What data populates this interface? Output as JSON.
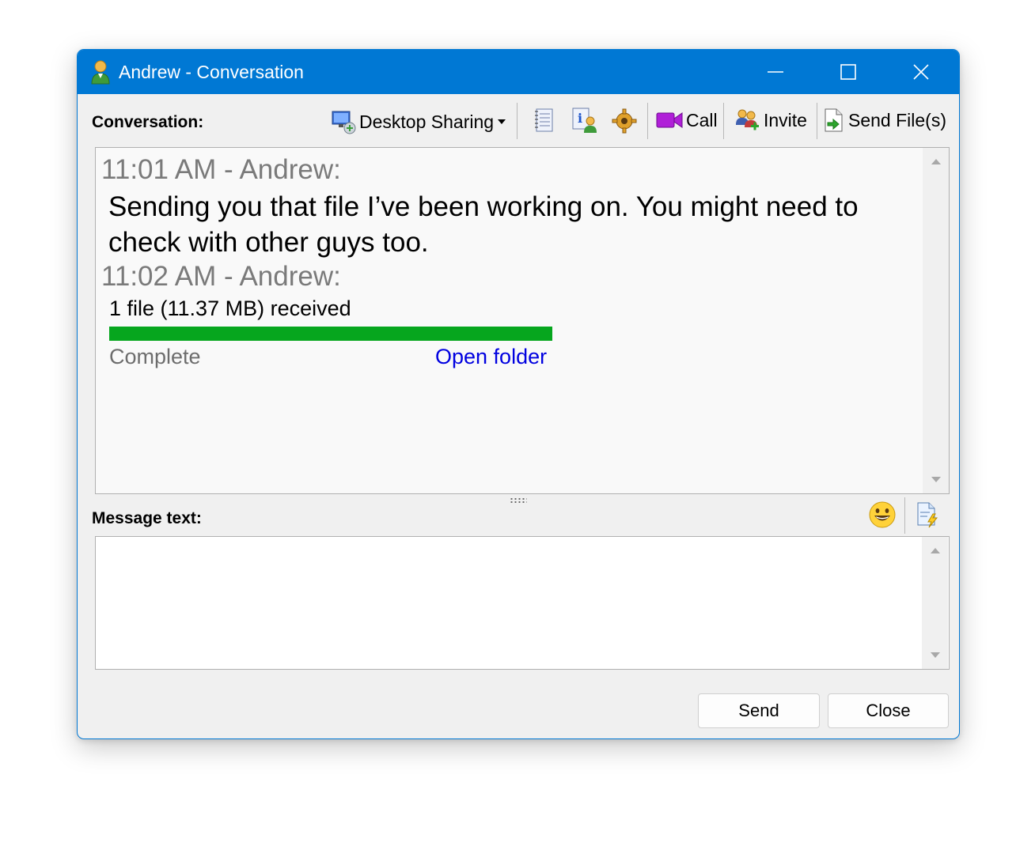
{
  "window": {
    "title": "Andrew - Conversation",
    "accent_color": "#0078d4"
  },
  "toolbar": {
    "conversation_label": "Conversation:",
    "desktop_sharing_label": "Desktop Sharing",
    "call_label": "Call",
    "invite_label": "Invite",
    "send_files_label": "Send File(s)",
    "icons": [
      "desktop-sharing-icon",
      "dropdown-arrow-icon",
      "notebook-icon",
      "user-info-icon",
      "settings-gear-icon",
      "video-camera-icon",
      "invite-users-icon",
      "send-file-icon"
    ]
  },
  "conversation": {
    "messages": [
      {
        "header": "11:01 AM - Andrew:",
        "body": "Sending you that file I’ve been working on. You might need to check with other guys too."
      },
      {
        "header": "11:02 AM - Andrew:",
        "file_text": "1 file (11.37 MB) received",
        "progress_percent": 100,
        "progress_color": "#06a61e",
        "status": "Complete",
        "link": "Open folder"
      }
    ]
  },
  "message_area": {
    "label": "Message text:",
    "value": "",
    "icons": [
      "emoji-smiley-icon",
      "quick-text-icon"
    ]
  },
  "buttons": {
    "send": "Send",
    "close": "Close"
  }
}
